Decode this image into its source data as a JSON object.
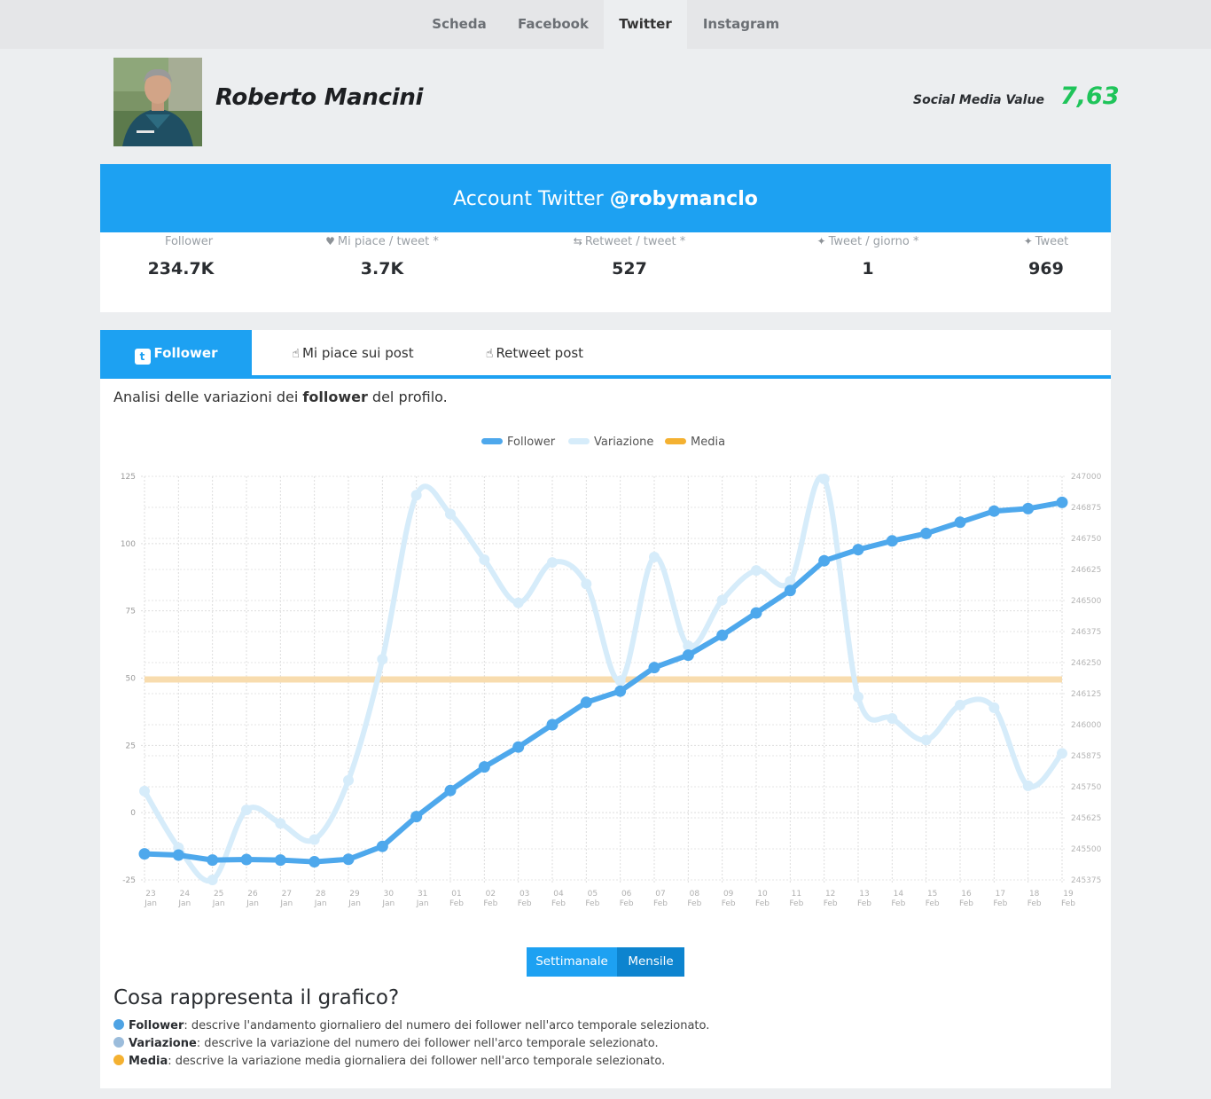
{
  "nav": {
    "tabs": [
      {
        "label": "Scheda",
        "active": false
      },
      {
        "label": "Facebook",
        "active": false
      },
      {
        "label": "Twitter",
        "active": true
      },
      {
        "label": "Instagram",
        "active": false
      }
    ]
  },
  "profile": {
    "name": "Roberto Mancini",
    "smv_label": "Social Media Value",
    "smv_value": "7,63"
  },
  "account": {
    "title_prefix": "Account Twitter",
    "handle": "@robymanclo",
    "stats": [
      {
        "label": "Follower",
        "value": "234.7K",
        "icon": ""
      },
      {
        "label": "Mi piace / tweet *",
        "value": "3.7K",
        "icon": "heart-icon"
      },
      {
        "label": "Retweet / tweet *",
        "value": "527",
        "icon": "retweet-icon"
      },
      {
        "label": "Tweet / giorno *",
        "value": "1",
        "icon": "twitter-bird-icon"
      },
      {
        "label": "Tweet",
        "value": "969",
        "icon": "twitter-bird-icon"
      }
    ]
  },
  "analysis": {
    "tabs": [
      {
        "label": "Follower",
        "active": true,
        "icon": "twitter-icon"
      },
      {
        "label": "Mi piace sui post",
        "active": false,
        "icon": "thumbs-up-icon"
      },
      {
        "label": "Retweet post",
        "active": false,
        "icon": "thumbs-up-icon"
      }
    ],
    "intro_prefix": "Analisi delle variazioni dei ",
    "intro_bold": "follower",
    "intro_suffix": " del profilo.",
    "buttons": {
      "weekly": "Settimanale",
      "monthly": "Mensile"
    },
    "explain_title": "Cosa rappresenta il grafico?",
    "explain": [
      {
        "term": "Follower",
        "text": ": descrive l'andamento giornaliero del numero dei follower nell'arco temporale selezionato.",
        "color": "#4ea3e4"
      },
      {
        "term": "Variazione",
        "text": ": descrive la variazione del numero dei follower nell'arco temporale selezionato.",
        "color": "#9bbcdb"
      },
      {
        "term": "Media",
        "text": ": descrive la variazione media giornaliera dei follower nell'arco temporale selezionato.",
        "color": "#f4b131"
      }
    ]
  },
  "chart_data": {
    "type": "line",
    "legend": [
      "Follower",
      "Variazione",
      "Media"
    ],
    "legend_position": "top-center",
    "grid": true,
    "x": [
      {
        "day": "23",
        "month": "Jan"
      },
      {
        "day": "24",
        "month": "Jan"
      },
      {
        "day": "25",
        "month": "Jan"
      },
      {
        "day": "26",
        "month": "Jan"
      },
      {
        "day": "27",
        "month": "Jan"
      },
      {
        "day": "28",
        "month": "Jan"
      },
      {
        "day": "29",
        "month": "Jan"
      },
      {
        "day": "30",
        "month": "Jan"
      },
      {
        "day": "31",
        "month": "Jan"
      },
      {
        "day": "01",
        "month": "Feb"
      },
      {
        "day": "02",
        "month": "Feb"
      },
      {
        "day": "03",
        "month": "Feb"
      },
      {
        "day": "04",
        "month": "Feb"
      },
      {
        "day": "05",
        "month": "Feb"
      },
      {
        "day": "06",
        "month": "Feb"
      },
      {
        "day": "07",
        "month": "Feb"
      },
      {
        "day": "08",
        "month": "Feb"
      },
      {
        "day": "09",
        "month": "Feb"
      },
      {
        "day": "10",
        "month": "Feb"
      },
      {
        "day": "11",
        "month": "Feb"
      },
      {
        "day": "12",
        "month": "Feb"
      },
      {
        "day": "13",
        "month": "Feb"
      },
      {
        "day": "14",
        "month": "Feb"
      },
      {
        "day": "15",
        "month": "Feb"
      },
      {
        "day": "16",
        "month": "Feb"
      },
      {
        "day": "17",
        "month": "Feb"
      },
      {
        "day": "18",
        "month": "Feb"
      },
      {
        "day": "19",
        "month": "Feb"
      }
    ],
    "left_axis": {
      "ylim": [
        -25,
        125
      ],
      "ticks": [
        125,
        100,
        75,
        50,
        25,
        0,
        -25
      ]
    },
    "right_axis": {
      "ylim": [
        245375,
        247000
      ],
      "ticks": [
        247000,
        246875,
        246750,
        246625,
        246500,
        246375,
        246250,
        246125,
        246000,
        245875,
        245750,
        245625,
        245500,
        245375
      ]
    },
    "series": [
      {
        "name": "Follower",
        "axis": "right",
        "color": "#4ea8ec",
        "values": [
          245480,
          245475,
          245455,
          245457,
          245455,
          245448,
          245458,
          245510,
          245630,
          245735,
          245830,
          245910,
          246000,
          246090,
          246135,
          246230,
          246280,
          246360,
          246450,
          246540,
          246660,
          246705,
          246740,
          246770,
          246815,
          246860,
          246870,
          246895
        ]
      },
      {
        "name": "Variazione",
        "axis": "left",
        "color": "#d6ecfa",
        "values": [
          8,
          -13,
          -25,
          1,
          -4,
          -10,
          12,
          57,
          118,
          111,
          94,
          78,
          93,
          85,
          49,
          95,
          62,
          79,
          90,
          86,
          124,
          43,
          35,
          27,
          40,
          39,
          10,
          22
        ]
      },
      {
        "name": "Media",
        "axis": "left",
        "color": "#f8dcae",
        "values": [
          49.5
        ]
      }
    ]
  }
}
